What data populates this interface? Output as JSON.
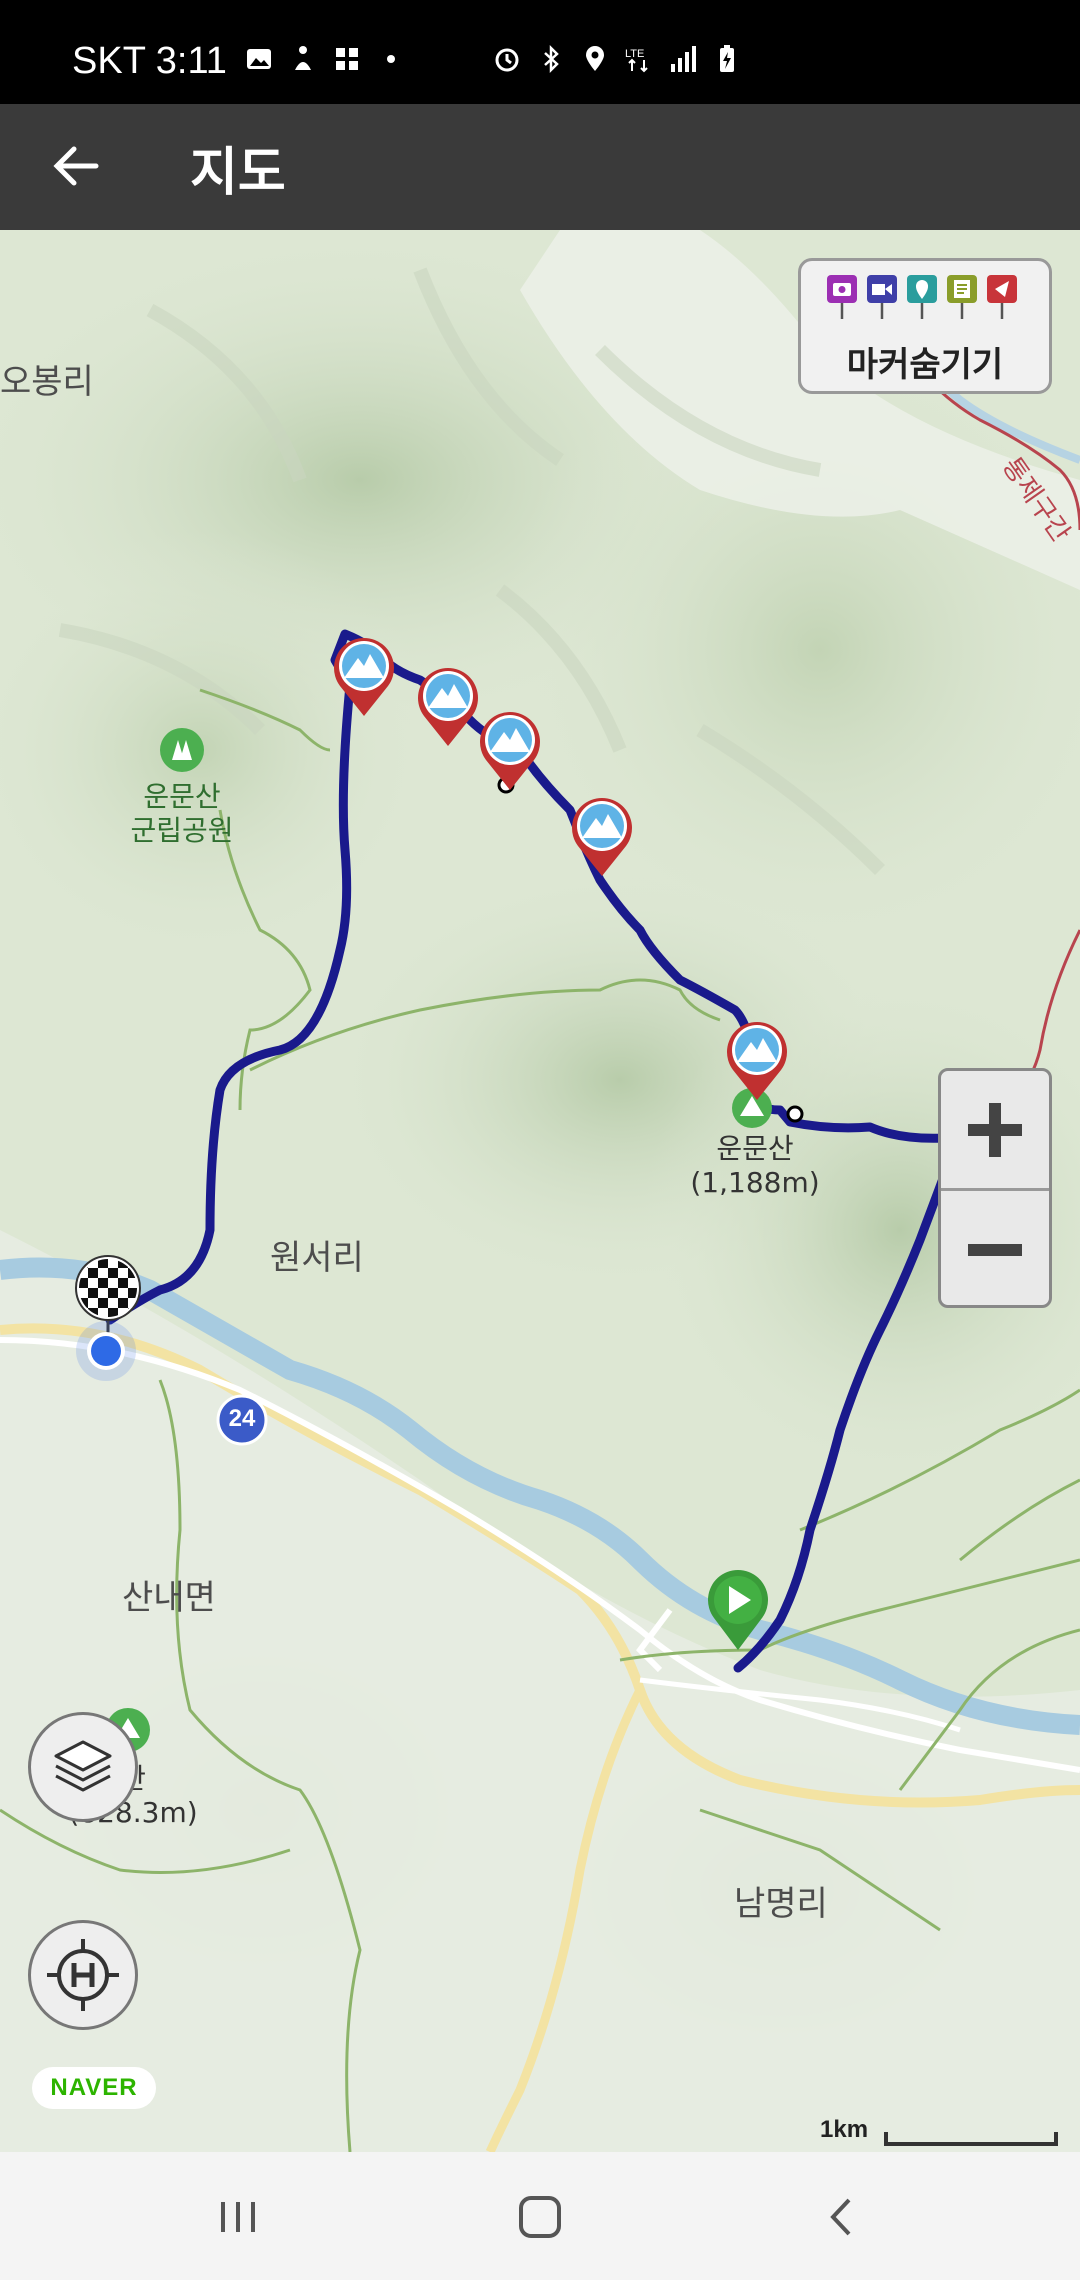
{
  "status_bar": {
    "time": "SKT 3:11",
    "left_icons": [
      "gallery-icon",
      "accessibility-icon",
      "grid-icon",
      "dot-icon"
    ],
    "right_icons": [
      "alarm-icon",
      "bluetooth-icon",
      "location-icon",
      "lte-icon",
      "signal-icon",
      "battery-icon"
    ]
  },
  "appbar": {
    "title": "지도",
    "back_icon": "arrow-left-icon"
  },
  "marker_hide": {
    "label": "마커숨기기",
    "marker_types": [
      {
        "icon": "camera-icon",
        "color": "#9c2fb3"
      },
      {
        "icon": "video-icon",
        "color": "#3f3fa8"
      },
      {
        "icon": "pin-icon",
        "color": "#2a9d9d"
      },
      {
        "icon": "note-icon",
        "color": "#8a9d2a"
      },
      {
        "icon": "flag-icon",
        "color": "#c8343a"
      }
    ]
  },
  "map": {
    "place_labels": {
      "obong": "오봉리",
      "wonseo": "원서리",
      "sannae": "산내면",
      "nammyeong": "남명리",
      "restricted": "통제구간"
    },
    "park": {
      "name_line1": "운문산",
      "name_line2": "군립공원"
    },
    "peak_main": {
      "name": "운문산",
      "elevation": "(1,188m)"
    },
    "peak_left": {
      "name": "산",
      "elevation": "(828.3m)"
    },
    "road_shield": "24",
    "route_color": "#1a1a8c"
  },
  "controls": {
    "zoom_in": "+",
    "zoom_out": "−",
    "layers_icon": "layers-icon",
    "location_icon": "h-crosshair-icon",
    "attribution": "NAVER",
    "scale_label": "1km"
  },
  "navbar": {
    "recents_icon": "recents-icon",
    "home_icon": "home-icon",
    "back_icon": "back-icon"
  }
}
